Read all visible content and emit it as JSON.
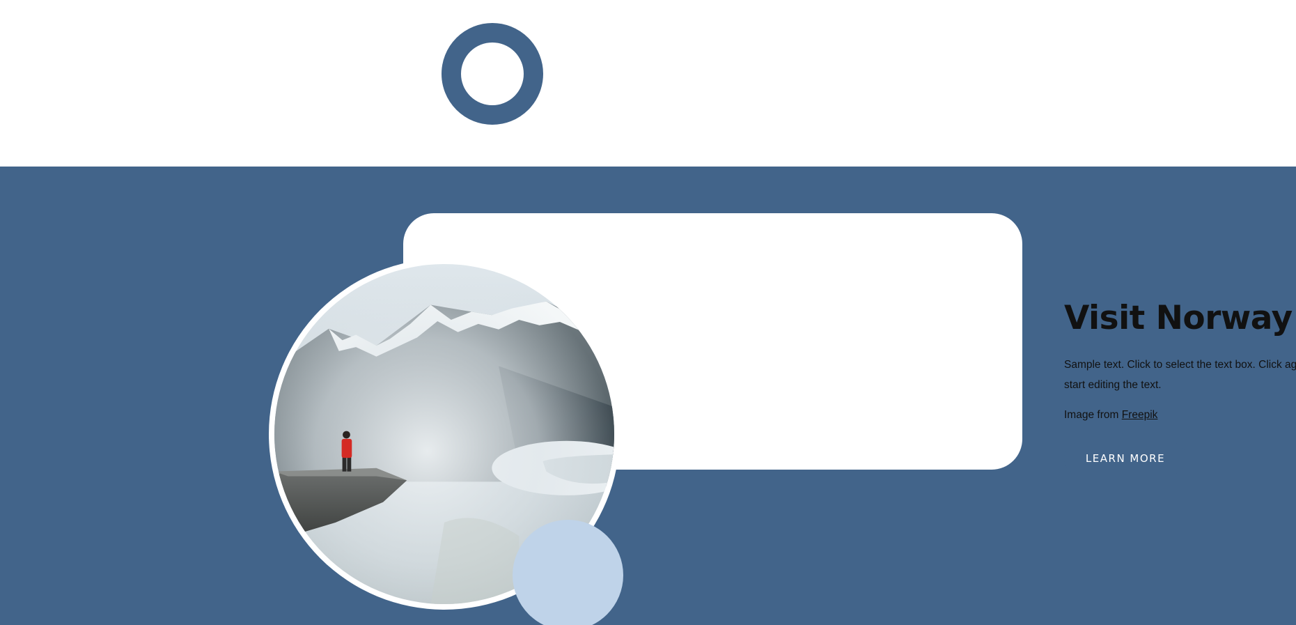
{
  "hero": {
    "title": "Visit Norway",
    "body": "Sample text. Click to select the text box. Click again or double click to start editing the text.",
    "credit_prefix": "Image from ",
    "credit_link": "Freepik",
    "button_label": "LEARN MORE"
  },
  "colors": {
    "brand_blue": "#42648a",
    "light_blue": "#bfd3e9",
    "card_bg": "#ffffff",
    "text": "#111111"
  },
  "icons": {
    "ring": "ring-decoration-icon"
  }
}
